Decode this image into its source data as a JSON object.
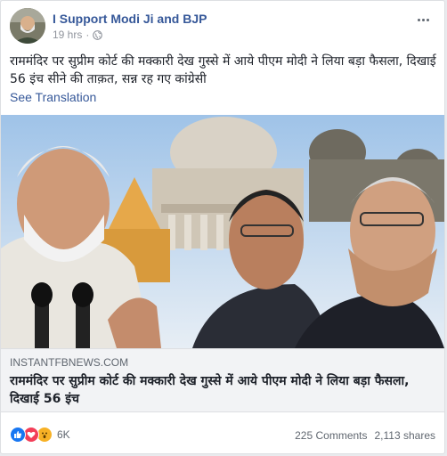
{
  "post": {
    "page_name": "I Support Modi Ji and BJP",
    "time": "19 hrs",
    "separator": "·",
    "privacy_icon": "globe-icon",
    "more_icon": "more-options-icon",
    "text": "राममंदिर पर सुप्रीम कोर्ट की मक्कारी देख गुस्से में आये पीएम मोदी ने लिया बड़ा फैसला, दिखाई 56 इंच सीने की ताक़त, सन्न रह गए कांग्रेसी",
    "see_translation": "See Translation"
  },
  "link_preview": {
    "domain": "INSTANTFBNEWS.COM",
    "title": "राममंदिर पर सुप्रीम कोर्ट की मक्कारी देख गुस्से में आये पीएम मोदी ने लिया बड़ा फैसला, दिखाई 56 इंच"
  },
  "footer": {
    "reaction_icons": [
      "like-icon",
      "love-icon",
      "wow-icon"
    ],
    "reaction_count": "6K",
    "comments": "225 Comments",
    "shares": "2,113 shares"
  },
  "colors": {
    "link_blue": "#365899",
    "meta_gray": "#90949c",
    "like_blue": "#1877f2",
    "love_red": "#f33e58",
    "wow_yellow": "#f7b125"
  }
}
